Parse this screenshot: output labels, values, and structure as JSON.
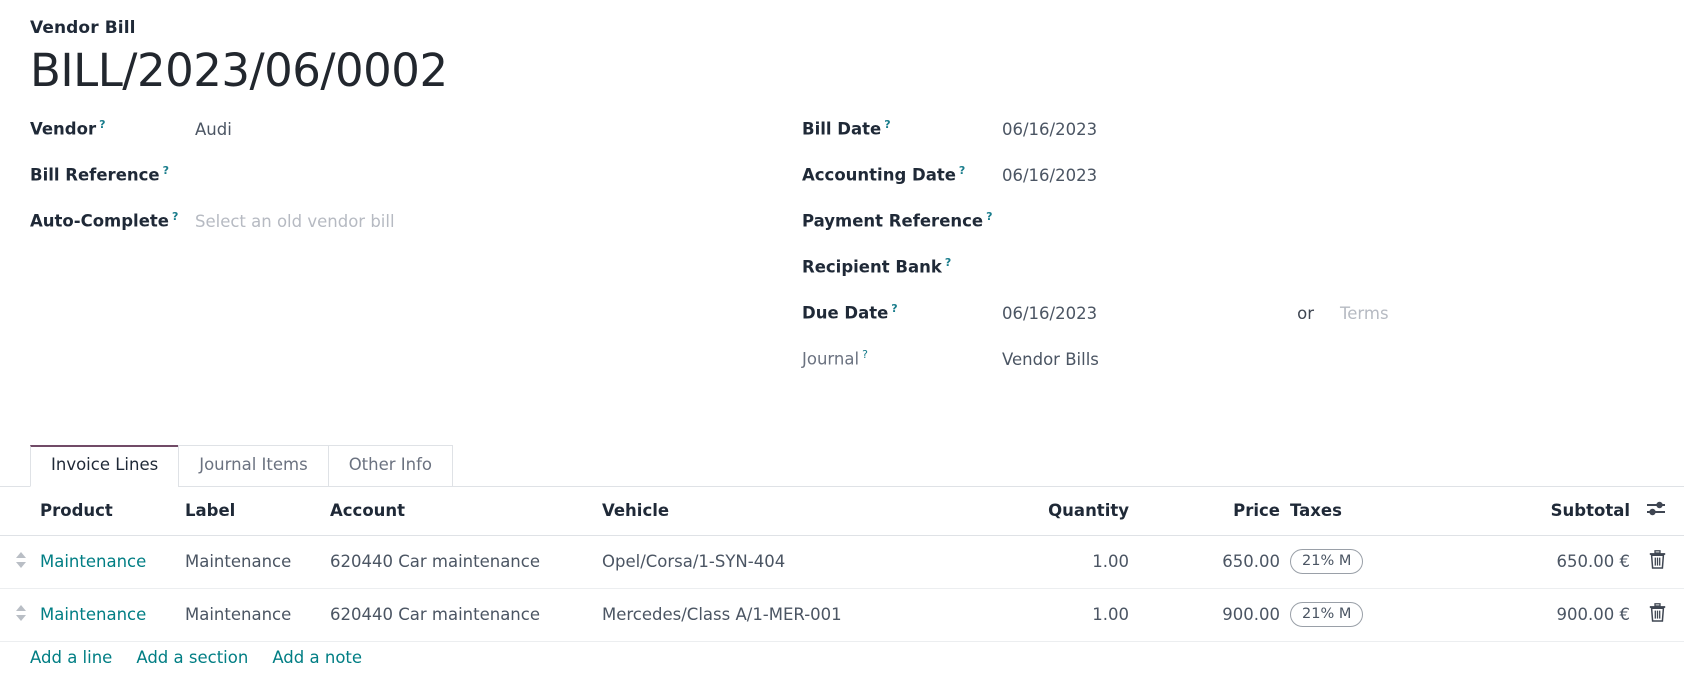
{
  "document": {
    "type_label": "Vendor Bill",
    "number": "BILL/2023/06/0002"
  },
  "help_marker": "?",
  "left_fields": [
    {
      "label": "Vendor",
      "value": "Audi",
      "placeholder": false
    },
    {
      "label": "Bill Reference",
      "value": "",
      "placeholder": false
    },
    {
      "label": "Auto-Complete",
      "value": "Select an old vendor bill",
      "placeholder": true
    }
  ],
  "right_fields": [
    {
      "label": "Bill Date",
      "value": "06/16/2023"
    },
    {
      "label": "Accounting Date",
      "value": "06/16/2023"
    },
    {
      "label": "Payment Reference",
      "value": ""
    },
    {
      "label": "Recipient Bank",
      "value": ""
    },
    {
      "label": "Due Date",
      "value": "06/16/2023"
    },
    {
      "label": "Journal",
      "value": "Vendor Bills"
    }
  ],
  "due_date_extra": {
    "or_word": "or",
    "terms_placeholder": "Terms"
  },
  "tabs": [
    {
      "label": "Invoice Lines",
      "active": true
    },
    {
      "label": "Journal Items",
      "active": false
    },
    {
      "label": "Other Info",
      "active": false
    }
  ],
  "table": {
    "columns": [
      "Product",
      "Label",
      "Account",
      "Vehicle",
      "Quantity",
      "Price",
      "Taxes",
      "Subtotal"
    ],
    "optional_columns_icon": "sliders-icon",
    "rows": [
      {
        "handle_icon": "drag-handle-icon",
        "product": "Maintenance",
        "label": "Maintenance",
        "account": "620440 Car maintenance",
        "vehicle": "Opel/Corsa/1-SYN-404",
        "quantity": "1.00",
        "price": "650.00",
        "taxes": "21% M",
        "subtotal": "650.00 €",
        "delete_icon": "trash-icon"
      },
      {
        "handle_icon": "drag-handle-icon",
        "product": "Maintenance",
        "label": "Maintenance",
        "account": "620440 Car maintenance",
        "vehicle": "Mercedes/Class A/1-MER-001",
        "quantity": "1.00",
        "price": "900.00",
        "taxes": "21% M",
        "subtotal": "900.00 €",
        "delete_icon": "trash-icon"
      }
    ]
  },
  "footer_links": [
    {
      "label": "Add a line"
    },
    {
      "label": "Add a section"
    },
    {
      "label": "Add a note"
    }
  ],
  "colors": {
    "link_teal": "#017e84",
    "help_blue": "#1a7d8c",
    "active_tab_accent": "#714b67",
    "text_dark": "#1f2937",
    "text_muted": "#6b7280",
    "placeholder": "#b6bac2"
  }
}
